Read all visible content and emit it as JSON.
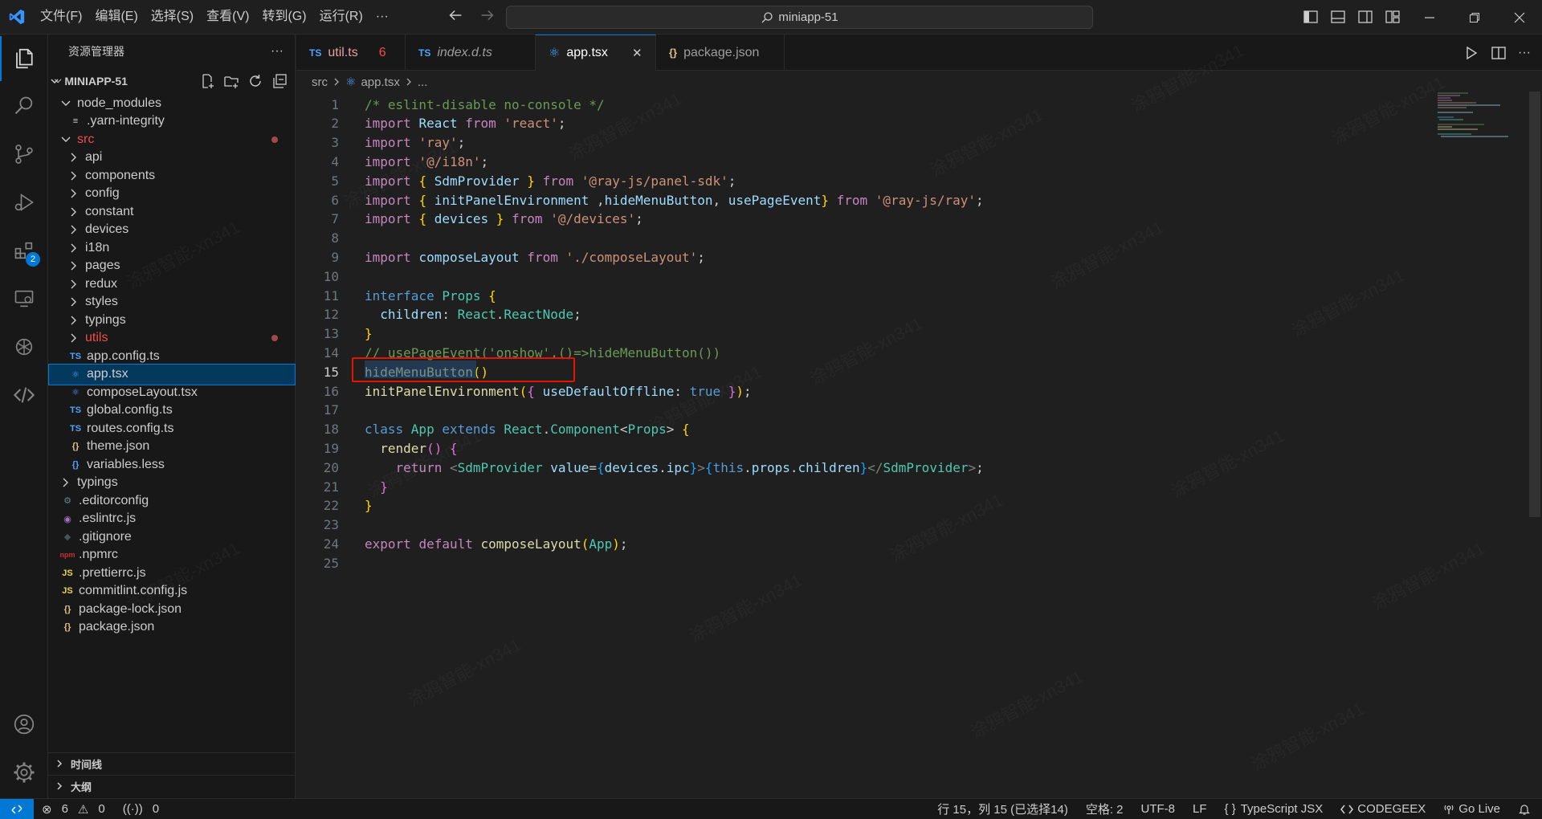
{
  "menu": [
    "文件(F)",
    "编辑(E)",
    "选择(S)",
    "查看(V)",
    "转到(G)",
    "运行(R)",
    "···"
  ],
  "command_center": {
    "text": "miniapp-51"
  },
  "activity": {
    "extensions_badge": "2"
  },
  "sidebar": {
    "title": "资源管理器",
    "more": "···",
    "root": "MINIAPP-51",
    "items": [
      {
        "label": "node_modules",
        "kind": "folder-open",
        "indent": 1
      },
      {
        "label": ".yarn-integrity",
        "kind": "lines",
        "indent": 2
      },
      {
        "label": "src",
        "kind": "folder-open",
        "indent": 1,
        "modified": true
      },
      {
        "label": "api",
        "kind": "folder",
        "indent": 2
      },
      {
        "label": "components",
        "kind": "folder",
        "indent": 2
      },
      {
        "label": "config",
        "kind": "folder",
        "indent": 2
      },
      {
        "label": "constant",
        "kind": "folder",
        "indent": 2
      },
      {
        "label": "devices",
        "kind": "folder",
        "indent": 2
      },
      {
        "label": "i18n",
        "kind": "folder",
        "indent": 2
      },
      {
        "label": "pages",
        "kind": "folder",
        "indent": 2
      },
      {
        "label": "redux",
        "kind": "folder",
        "indent": 2
      },
      {
        "label": "styles",
        "kind": "folder",
        "indent": 2
      },
      {
        "label": "typings",
        "kind": "folder",
        "indent": 2
      },
      {
        "label": "utils",
        "kind": "folder",
        "indent": 2,
        "modified": true
      },
      {
        "label": "app.config.ts",
        "kind": "ts",
        "indent": 2
      },
      {
        "label": "app.tsx",
        "kind": "react",
        "indent": 2,
        "selected": true
      },
      {
        "label": "composeLayout.tsx",
        "kind": "react",
        "indent": 2
      },
      {
        "label": "global.config.ts",
        "kind": "ts",
        "indent": 2
      },
      {
        "label": "routes.config.ts",
        "kind": "ts",
        "indent": 2
      },
      {
        "label": "theme.json",
        "kind": "json",
        "indent": 2
      },
      {
        "label": "variables.less",
        "kind": "less",
        "indent": 2
      },
      {
        "label": "typings",
        "kind": "folder",
        "indent": 1
      },
      {
        "label": ".editorconfig",
        "kind": "gear",
        "indent": 1
      },
      {
        "label": ".eslintrc.js",
        "kind": "eslint",
        "indent": 1
      },
      {
        "label": ".gitignore",
        "kind": "git",
        "indent": 1
      },
      {
        "label": ".npmrc",
        "kind": "npm",
        "indent": 1
      },
      {
        "label": ".prettierrc.js",
        "kind": "js",
        "indent": 1
      },
      {
        "label": "commitlint.config.js",
        "kind": "js",
        "indent": 1
      },
      {
        "label": "package-lock.json",
        "kind": "json",
        "indent": 1
      },
      {
        "label": "package.json",
        "kind": "json",
        "indent": 1
      }
    ],
    "timeline": "时间线",
    "outline": "大纲"
  },
  "icon_text": {
    "ts": "TS",
    "js": "JS",
    "json": "{}",
    "npm": "npm"
  },
  "tabs": [
    {
      "label": "util.ts",
      "kind": "ts",
      "errors": "6",
      "modified": true
    },
    {
      "label": "index.d.ts",
      "kind": "ts",
      "italic": true
    },
    {
      "label": "app.tsx",
      "kind": "react",
      "active": true
    },
    {
      "label": "package.json",
      "kind": "json"
    }
  ],
  "breadcrumb": {
    "folder": "src",
    "file": "app.tsx",
    "more": "..."
  },
  "code": {
    "current_line": 15,
    "lines": [
      [
        [
          "c",
          "/* eslint-disable no-console */"
        ]
      ],
      [
        [
          "kc",
          "import "
        ],
        [
          "v",
          "React "
        ],
        [
          "kc",
          "from "
        ],
        [
          "s",
          "'react'"
        ],
        [
          "p",
          ";"
        ]
      ],
      [
        [
          "kc",
          "import "
        ],
        [
          "s",
          "'ray'"
        ],
        [
          "p",
          ";"
        ]
      ],
      [
        [
          "kc",
          "import "
        ],
        [
          "s",
          "'@/i18n'"
        ],
        [
          "p",
          ";"
        ]
      ],
      [
        [
          "kc",
          "import "
        ],
        [
          "y",
          "{ "
        ],
        [
          "v",
          "SdmProvider "
        ],
        [
          "y",
          "} "
        ],
        [
          "kc",
          "from "
        ],
        [
          "s",
          "'@ray-js/panel-sdk'"
        ],
        [
          "p",
          ";"
        ]
      ],
      [
        [
          "kc",
          "import "
        ],
        [
          "y",
          "{ "
        ],
        [
          "v",
          "initPanelEnvironment "
        ],
        [
          "p",
          ","
        ],
        [
          "v",
          "hideMenuButton"
        ],
        [
          "p",
          ", "
        ],
        [
          "v",
          "usePageEvent"
        ],
        [
          "y",
          "} "
        ],
        [
          "kc",
          "from "
        ],
        [
          "s",
          "'@ray-js/ray'"
        ],
        [
          "p",
          ";"
        ]
      ],
      [
        [
          "kc",
          "import "
        ],
        [
          "y",
          "{ "
        ],
        [
          "v",
          "devices "
        ],
        [
          "y",
          "} "
        ],
        [
          "kc",
          "from "
        ],
        [
          "s",
          "'@/devices'"
        ],
        [
          "p",
          ";"
        ]
      ],
      [],
      [
        [
          "kc",
          "import "
        ],
        [
          "v",
          "composeLayout "
        ],
        [
          "kc",
          "from "
        ],
        [
          "s",
          "'./composeLayout'"
        ],
        [
          "p",
          ";"
        ]
      ],
      [],
      [
        [
          "k",
          "interface "
        ],
        [
          "t",
          "Props "
        ],
        [
          "y",
          "{"
        ]
      ],
      [
        [
          "p",
          "  "
        ],
        [
          "v",
          "children"
        ],
        [
          "p",
          ": "
        ],
        [
          "t",
          "React"
        ],
        [
          "p",
          "."
        ],
        [
          "t",
          "ReactNode"
        ],
        [
          "p",
          ";"
        ]
      ],
      [
        [
          "y",
          "}"
        ]
      ],
      [
        [
          "c",
          "// usePageEvent('onshow',()=>hideMenuButton())"
        ]
      ],
      [
        [
          "f",
          "hideMenuButton"
        ],
        [
          "y",
          "()"
        ]
      ],
      [
        [
          "f",
          "initPanelEnvironment"
        ],
        [
          "y",
          "("
        ],
        [
          "pk",
          "{ "
        ],
        [
          "v",
          "useDefaultOffline"
        ],
        [
          "p",
          ": "
        ],
        [
          "k",
          "true "
        ],
        [
          "pk",
          "}"
        ],
        [
          "y",
          ")"
        ],
        [
          "p",
          ";"
        ]
      ],
      [],
      [
        [
          "k",
          "class "
        ],
        [
          "t",
          "App "
        ],
        [
          "k",
          "extends "
        ],
        [
          "t",
          "React"
        ],
        [
          "p",
          "."
        ],
        [
          "t",
          "Component"
        ],
        [
          "p",
          "<"
        ],
        [
          "t",
          "Props"
        ],
        [
          "p",
          "> "
        ],
        [
          "y",
          "{"
        ]
      ],
      [
        [
          "p",
          "  "
        ],
        [
          "f",
          "render"
        ],
        [
          "pk",
          "() {"
        ]
      ],
      [
        [
          "p",
          "    "
        ],
        [
          "kc",
          "return "
        ],
        [
          "tag",
          "<"
        ],
        [
          "t",
          "SdmProvider "
        ],
        [
          "v",
          "value"
        ],
        [
          "p",
          "="
        ],
        [
          "b",
          "{"
        ],
        [
          "v",
          "devices"
        ],
        [
          "p",
          "."
        ],
        [
          "v",
          "ipc"
        ],
        [
          "b",
          "}"
        ],
        [
          "tag",
          ">"
        ],
        [
          "b",
          "{"
        ],
        [
          "k",
          "this"
        ],
        [
          "p",
          "."
        ],
        [
          "v",
          "props"
        ],
        [
          "p",
          "."
        ],
        [
          "v",
          "children"
        ],
        [
          "b",
          "}"
        ],
        [
          "tag",
          "</"
        ],
        [
          "t",
          "SdmProvider"
        ],
        [
          "tag",
          ">"
        ],
        [
          "p",
          ";"
        ]
      ],
      [
        [
          "p",
          "  "
        ],
        [
          "pk",
          "}"
        ]
      ],
      [
        [
          "y",
          "}"
        ]
      ],
      [],
      [
        [
          "kc",
          "export "
        ],
        [
          "kc",
          "default "
        ],
        [
          "f",
          "composeLayout"
        ],
        [
          "y",
          "("
        ],
        [
          "t",
          "App"
        ],
        [
          "y",
          ")"
        ],
        [
          "p",
          ";"
        ]
      ],
      []
    ]
  },
  "status": {
    "errors": "6",
    "warnings": "0",
    "ports": "0",
    "position": "行 15，列 15 (已选择14)",
    "spaces": "空格: 2",
    "encoding": "UTF-8",
    "eol": "LF",
    "language_brace": "{ }",
    "language": "TypeScript JSX",
    "codegeex": "CODEGEEX",
    "golive": "Go Live"
  },
  "watermark": "涂鸦智能-xn341"
}
